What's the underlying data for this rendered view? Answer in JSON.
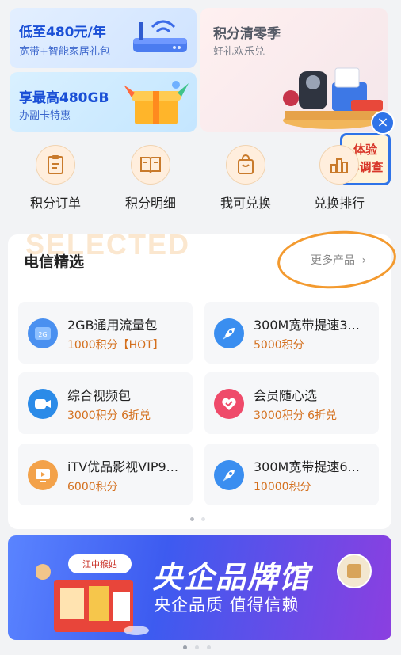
{
  "promos": {
    "broadband": {
      "title": "低至480元/年",
      "subtitle": "宽带+智能家居礼包"
    },
    "sim": {
      "title": "享最高480GB",
      "subtitle": "办副卡特惠"
    },
    "points_clear": {
      "title": "积分清零季",
      "subtitle": "好礼欢乐兑"
    }
  },
  "survey": {
    "line1": "体验",
    "line2": "小调查",
    "close_icon": "×"
  },
  "nav": [
    {
      "label": "积分订单",
      "icon": "clipboard-icon"
    },
    {
      "label": "积分明细",
      "icon": "book-icon"
    },
    {
      "label": "我可兑换",
      "icon": "bag-icon"
    },
    {
      "label": "兑换排行",
      "icon": "ranking-icon"
    }
  ],
  "selected": {
    "watermark": "SELECTED",
    "title": "电信精选",
    "more": "更多产品",
    "more_arrow": "›",
    "products": [
      {
        "name": "2GB通用流量包",
        "price": "1000积分【HOT】",
        "icon": "data-card-icon",
        "icon_text": "2G"
      },
      {
        "name": "300M宽带提速3...",
        "price": "5000积分",
        "icon": "rocket-icon"
      },
      {
        "name": "综合视频包",
        "price": "3000积分 6折兑",
        "icon": "video-camera-icon"
      },
      {
        "name": "会员随心选",
        "price": "3000积分 6折兑",
        "icon": "heart-icon"
      },
      {
        "name": "iTV优品影视VIP9...",
        "price": "6000积分",
        "icon": "tv-icon"
      },
      {
        "name": "300M宽带提速6...",
        "price": "10000积分",
        "icon": "rocket-icon"
      }
    ]
  },
  "banner": {
    "title": "央企品牌馆",
    "subtitle": "央企品质 值得信赖",
    "logo_text": "江中猴姑"
  },
  "colors": {
    "accent": "#d4701e",
    "brand_blue": "#1a4fd6",
    "annotation": "#f39a2f"
  }
}
